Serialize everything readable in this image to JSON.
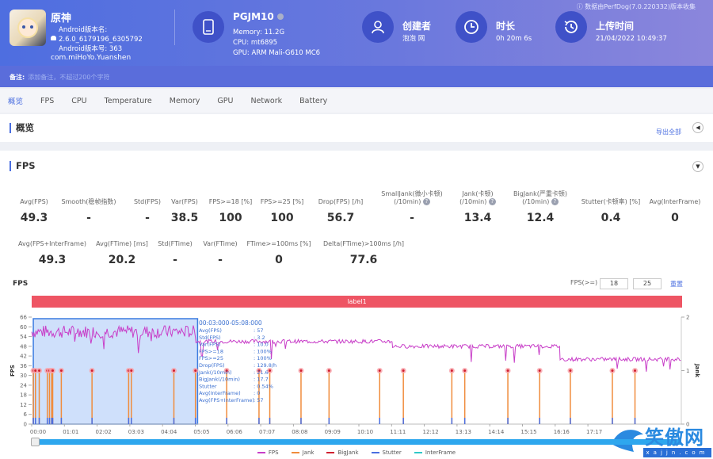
{
  "header": {
    "app": {
      "name": "原神",
      "version_name_label": "Android版本名:",
      "version_name": "2.6.0_6179196_6305792",
      "version_code_label": "Android版本号:",
      "version_code": "363",
      "package": "com.miHoYo.Yuanshen",
      "icon": "app-icon-genshin"
    },
    "device": {
      "name": "PGJM10",
      "memory": "Memory: 11.2G",
      "cpu": "CPU: mt6895",
      "gpu": "GPU: ARM Mali-G610 MC6",
      "icon": "tablet-icon"
    },
    "creator": {
      "title": "创建者",
      "value": "泡泡 网",
      "icon": "user-icon"
    },
    "duration": {
      "title": "时长",
      "value": "0h 20m 6s",
      "icon": "clock-icon"
    },
    "upload": {
      "title": "上传时间",
      "value": "21/04/2022 10:49:37",
      "icon": "history-icon"
    },
    "collect_note": "数据由PerfDog(7.0.220332)版本收集",
    "remark_label": "备注:",
    "remark_placeholder": "添加备注，不超过200个字符"
  },
  "tabs": [
    {
      "label": "概览",
      "active": true
    },
    {
      "label": "FPS"
    },
    {
      "label": "CPU"
    },
    {
      "label": "Temperature"
    },
    {
      "label": "Memory"
    },
    {
      "label": "GPU"
    },
    {
      "label": "Network"
    },
    {
      "label": "Battery"
    }
  ],
  "overview": {
    "title": "概览",
    "export_label": "导出全部"
  },
  "fps_section": {
    "title": "FPS",
    "metrics_row1": [
      {
        "label": "Avg(FPS)",
        "value": "49.3"
      },
      {
        "label": "Smooth(稳帧指数)",
        "value": "-",
        "help": true
      },
      {
        "label": "Std(FPS)",
        "value": "-"
      },
      {
        "label": "Var(FPS)",
        "value": "38.5"
      },
      {
        "label": "FPS>=18 [%]",
        "value": "100"
      },
      {
        "label": "FPS>=25 [%]",
        "value": "100"
      },
      {
        "label": "Drop(FPS) [/h]",
        "value": "56.7",
        "help": true
      },
      {
        "label": "SmallJank(微小卡顿)",
        "label2": "(/10min)",
        "value": "-",
        "help": true
      },
      {
        "label": "Jank(卡顿)",
        "label2": "(/10min)",
        "value": "13.4",
        "help": true
      },
      {
        "label": "BigJank(严重卡顿)",
        "label2": "(/10min)",
        "value": "12.4",
        "help": true
      },
      {
        "label": "Stutter(卡顿率) [%]",
        "value": "0.4"
      },
      {
        "label": "Avg(InterFrame)",
        "value": "0"
      }
    ],
    "metrics_row2": [
      {
        "label": "Avg(FPS+InterFrame)",
        "value": "49.3"
      },
      {
        "label": "Avg(FTime) [ms]",
        "value": "20.2"
      },
      {
        "label": "Std(FTime)",
        "value": "-"
      },
      {
        "label": "Var(FTime)",
        "value": "-"
      },
      {
        "label": "FTime>=100ms [%]",
        "value": "0"
      },
      {
        "label": "Delta(FTime)>100ms [/h]",
        "value": "77.6",
        "help": true
      }
    ]
  },
  "chart_controls": {
    "title": "FPS",
    "threshold_label": "FPS(>=)",
    "threshold1": "18",
    "threshold2": "25",
    "reset_label": "重置",
    "label_bar": "label1"
  },
  "tooltip": {
    "range": "00:03:000-05:08:000",
    "rows": [
      {
        "k": "Avg(FPS)",
        "v": ": 57"
      },
      {
        "k": "Std(FPS)",
        "v": ": 3.2"
      },
      {
        "k": "Var(FPS)",
        "v": ": 10.0"
      },
      {
        "k": "FPS>=18",
        "v": ": 100%"
      },
      {
        "k": "FPS>=25",
        "v": ": 100%"
      },
      {
        "k": "Drop(FPS)",
        "v": ": 129.8/h"
      },
      {
        "k": "Jank(/10min)",
        "v": ": 21.6"
      },
      {
        "k": "BigJank(/10min)",
        "v": ": 17.7"
      },
      {
        "k": "Stutter",
        "v": ": 0.54%"
      },
      {
        "k": "Avg(InterFrame)",
        "v": ": 0"
      },
      {
        "k": "Avg(FPS+InterFrame)",
        "v": ": 57"
      }
    ]
  },
  "chart_data": {
    "type": "line",
    "title": "FPS",
    "xlabel": "",
    "ylabel": "FPS",
    "y2label": "Jank",
    "ylim": [
      0,
      66
    ],
    "y2lim": [
      0,
      2
    ],
    "yticks": [
      0,
      6,
      12,
      18,
      24,
      30,
      36,
      42,
      48,
      54,
      60,
      66
    ],
    "y2ticks": [
      0,
      1,
      2
    ],
    "xlim_seconds": [
      0,
      1206
    ],
    "xticks": [
      "00:00",
      "01:01",
      "02:02",
      "03:03",
      "04:04",
      "05:05",
      "06:06",
      "07:07",
      "08:08",
      "09:09",
      "10:10",
      "11:11",
      "12:12",
      "13:13",
      "14:14",
      "15:15",
      "16:16",
      "17:17"
    ],
    "fps_segments": [
      {
        "start_s": 0,
        "end_s": 305,
        "avg_fps": 57
      },
      {
        "start_s": 305,
        "end_s": 670,
        "avg_fps": 51
      },
      {
        "start_s": 670,
        "end_s": 981,
        "avg_fps": 48
      },
      {
        "start_s": 981,
        "end_s": 1206,
        "avg_fps": 40
      }
    ],
    "jank_times_s": [
      3,
      7,
      14,
      29,
      33,
      37,
      39,
      55,
      112,
      180,
      185,
      264,
      304,
      362,
      422,
      442,
      500,
      552,
      646,
      690,
      780,
      804,
      884,
      943,
      1000,
      1078,
      1120
    ],
    "selection": {
      "start_s": 3,
      "end_s": 308
    },
    "series": [
      {
        "name": "FPS",
        "color": "#c83ec8"
      },
      {
        "name": "Jank",
        "color": "#f08c3c"
      },
      {
        "name": "BigJank",
        "color": "#d02030"
      },
      {
        "name": "Stutter",
        "color": "#4a6ee0"
      },
      {
        "name": "InterFrame",
        "color": "#30c8c8"
      }
    ],
    "legend_position": "bottom"
  },
  "watermark": {
    "text": "笑傲网",
    "sub": "xajjn.com"
  }
}
